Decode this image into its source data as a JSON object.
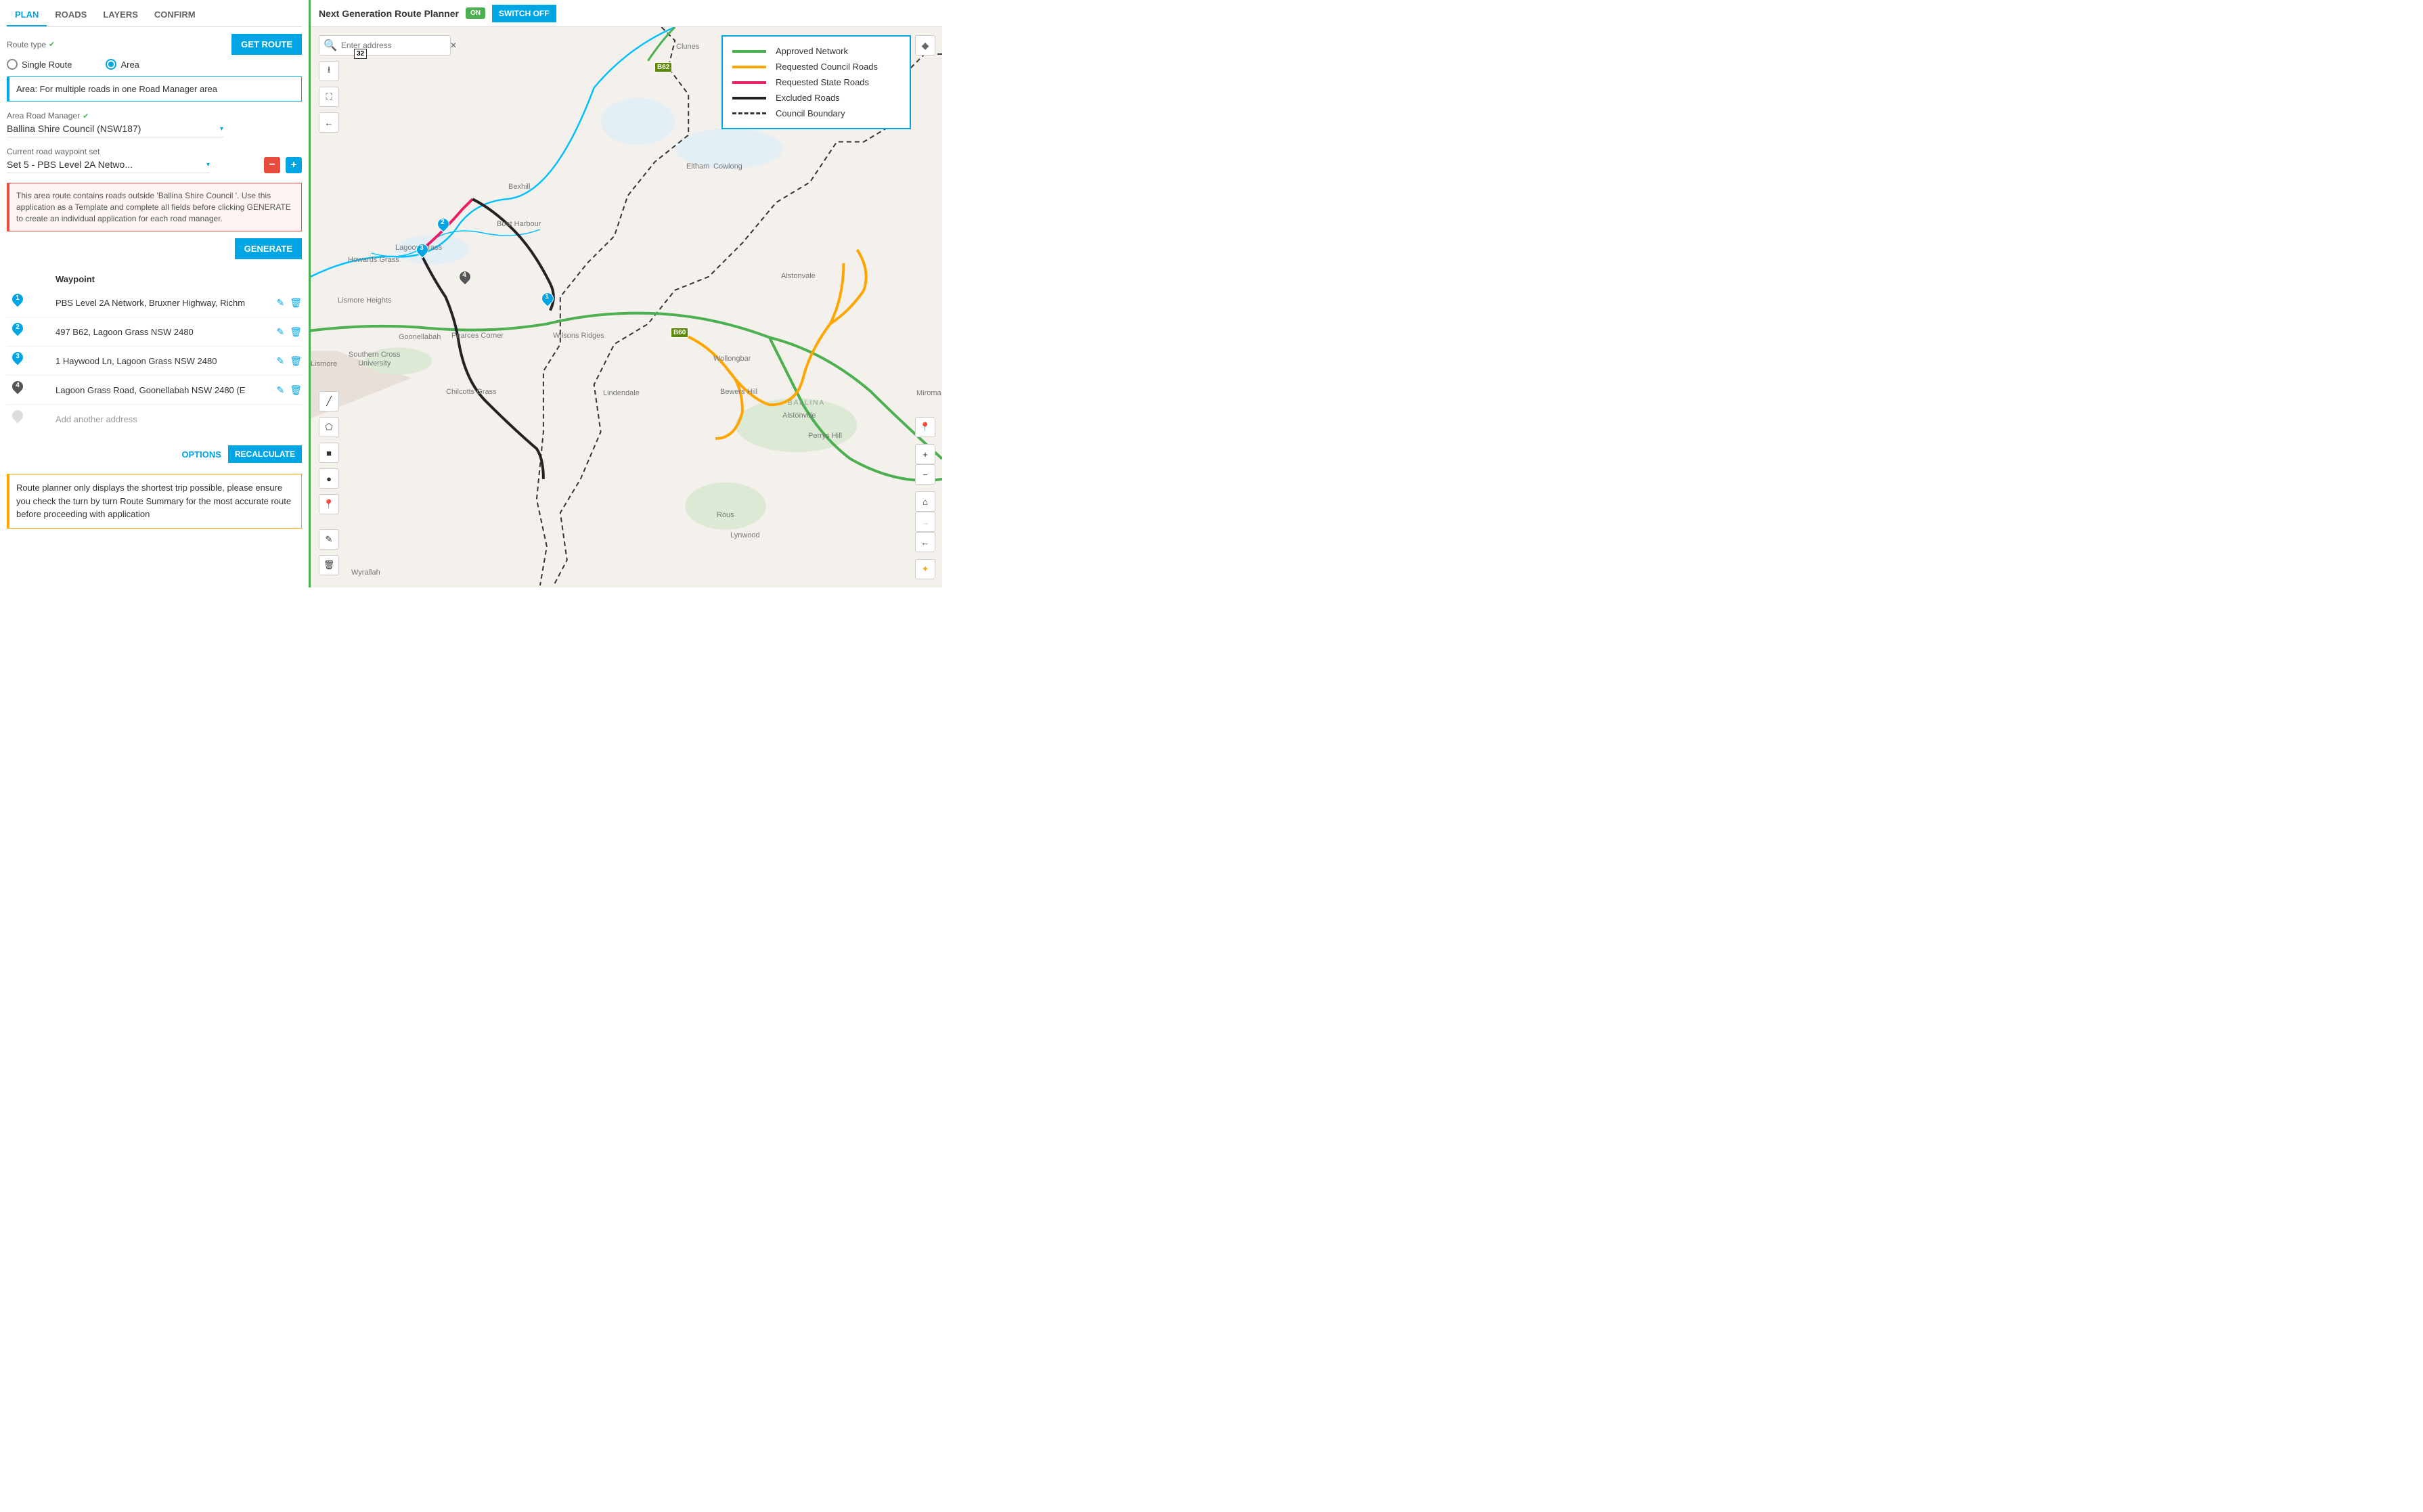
{
  "tabs": [
    "PLAN",
    "ROADS",
    "LAYERS",
    "CONFIRM"
  ],
  "activeTab": "PLAN",
  "routeType": {
    "label": "Route type",
    "options": [
      "Single Route",
      "Area"
    ],
    "selected": "Area"
  },
  "getRouteBtn": "GET ROUTE",
  "areaInfo": "Area: For multiple roads in one Road Manager area",
  "areaRoadManager": {
    "label": "Area Road Manager",
    "value": "Ballina Shire Council  (NSW187)"
  },
  "waypointSet": {
    "label": "Current road waypoint set",
    "value": "Set 5 - PBS Level 2A Netwo..."
  },
  "warning": "This area route contains roads outside 'Ballina Shire Council '. Use this application as a Template and complete all fields before clicking GENERATE to create an individual application for each road manager.",
  "generateBtn": "GENERATE",
  "waypointHeader": "Waypoint",
  "waypoints": [
    {
      "num": "1",
      "color": "blue",
      "text": "PBS Level 2A Network, Bruxner Highway, Richm"
    },
    {
      "num": "2",
      "color": "blue",
      "text": "497 B62, Lagoon Grass NSW 2480"
    },
    {
      "num": "3",
      "color": "blue",
      "text": "1 Haywood Ln, Lagoon Grass NSW 2480"
    },
    {
      "num": "4",
      "color": "dark",
      "text": "Lagoon Grass Road, Goonellabah NSW 2480 (E"
    }
  ],
  "addAnotherPlaceholder": "Add another address",
  "optionsBtn": "OPTIONS",
  "recalcBtn": "RECALCULATE",
  "note": "Route planner only displays the shortest trip possible, please ensure you check the turn by turn Route Summary for the most accurate route before proceeding with application",
  "mapHeader": {
    "title": "Next Generation Route Planner",
    "badge": "ON",
    "switchBtn": "SWITCH OFF"
  },
  "search": {
    "placeholder": "Enter address"
  },
  "legend": [
    {
      "color": "#4CAF50",
      "label": "Approved Network",
      "type": "line"
    },
    {
      "color": "#FFA500",
      "label": "Requested Council Roads",
      "type": "line"
    },
    {
      "color": "#E91E63",
      "label": "Requested State Roads",
      "type": "line"
    },
    {
      "color": "#222222",
      "label": "Excluded Roads",
      "type": "line"
    },
    {
      "color": "#333333",
      "label": "Council Boundary",
      "type": "dash"
    }
  ],
  "shields": {
    "r32": "32",
    "b62a": "B62",
    "b60": "B60"
  },
  "places": {
    "clunes": "Clunes",
    "bexhill": "Bexhill",
    "eltham": "Eltham",
    "cowlong": "Cowlong",
    "boatHarbour": "Boat Harbour",
    "lagoonGrass": "Lagoon Grass",
    "howardsGrass": "Howards Grass",
    "lismoreHeights": "Lismore Heights",
    "lismore": "Lismore",
    "goonellabah": "Goonellabah",
    "pearcesCorner": "Pearces Corner",
    "wilsonsRidges": "Wilsons Ridges",
    "chilcottsGrass": "Chilcotts Grass",
    "lindendale": "Lindendale",
    "wyrallah": "Wyrallah",
    "rous": "Rous",
    "lynwood": "Lynwood",
    "alstonvale": "Alstonvale",
    "wollongbar": "Wollongbar",
    "bewersHill": "Bewers Hill",
    "ballina": "BALLINA",
    "alstonville": "Alstonville",
    "perrysHill": "Perrys Hill",
    "scu": "Southern Cross\nUniversity",
    "miroma": "Miroma"
  }
}
